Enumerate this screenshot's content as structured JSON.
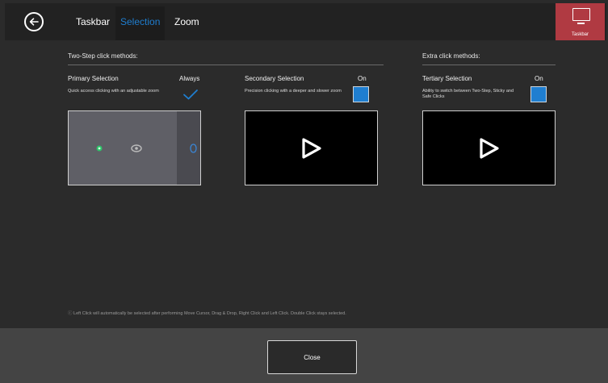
{
  "header": {
    "tabs": [
      {
        "label": "Taskbar",
        "active": false
      },
      {
        "label": "Selection",
        "active": true
      },
      {
        "label": "Zoom",
        "active": false
      }
    ],
    "corner_label": "Taskbar",
    "accent": "#1f7ed0",
    "corner_color": "#b03a42"
  },
  "sections": {
    "two_step": "Two-Step click methods:",
    "extra": "Extra click methods:"
  },
  "options": {
    "primary": {
      "title": "Primary Selection",
      "state": "Always",
      "description": "Quick access clicking with an adjustable zoom",
      "indicator": "checkmark-icon"
    },
    "secondary": {
      "title": "Secondary Selection",
      "state": "On",
      "description": "Precision clicking with a deeper and slower zoom",
      "indicator": "toggle"
    },
    "tertiary": {
      "title": "Tertiary Selection",
      "state": "On",
      "description": "Ability to switch between Two-Step, Sticky and Safe Clicks",
      "indicator": "toggle"
    }
  },
  "footnote": "ⓘ Left Click will automatically be selected after performing Move Cursor, Drag & Drop, Right Click and Left Click. Double Click stays selected.",
  "footer": {
    "close_label": "Close"
  }
}
